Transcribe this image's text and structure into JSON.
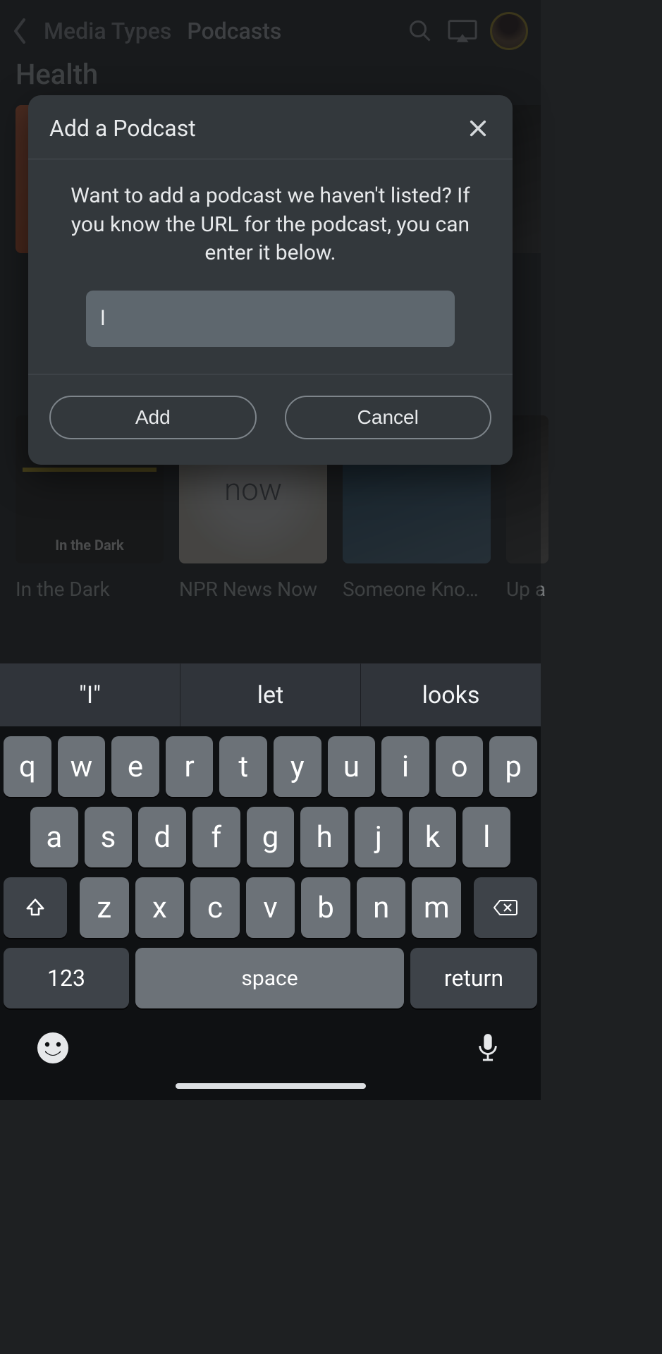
{
  "header": {
    "breadcrumb1": "Media Types",
    "breadcrumb2": "Podcasts"
  },
  "background": {
    "section1_title": "Health",
    "section2": {
      "items": [
        {
          "title": "In the Dark"
        },
        {
          "title": "NPR News Now"
        },
        {
          "title": "Someone Know…"
        },
        {
          "title": "Up a"
        }
      ]
    }
  },
  "modal": {
    "title": "Add a Podcast",
    "message": "Want to add a podcast we haven't listed? If you know the URL for the podcast, you can enter it below.",
    "input_value": "l",
    "add_label": "Add",
    "cancel_label": "Cancel"
  },
  "keyboard": {
    "suggestions": [
      "\"I\"",
      "let",
      "looks"
    ],
    "row1": [
      "q",
      "w",
      "e",
      "r",
      "t",
      "y",
      "u",
      "i",
      "o",
      "p"
    ],
    "row2": [
      "a",
      "s",
      "d",
      "f",
      "g",
      "h",
      "j",
      "k",
      "l"
    ],
    "row3": [
      "z",
      "x",
      "c",
      "v",
      "b",
      "n",
      "m"
    ],
    "numbers_label": "123",
    "space_label": "space",
    "return_label": "return"
  }
}
